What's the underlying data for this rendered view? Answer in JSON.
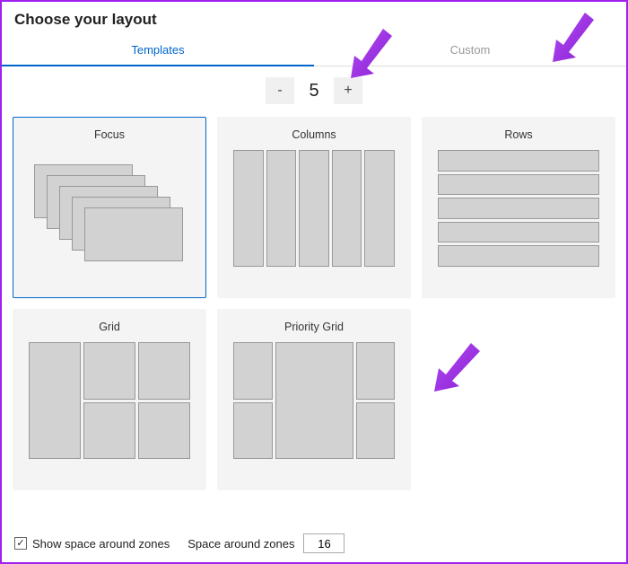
{
  "heading": "Choose your layout",
  "tabs": {
    "templates": "Templates",
    "custom": "Custom"
  },
  "stepper": {
    "minus": "-",
    "value": "5",
    "plus": "+"
  },
  "layouts": {
    "focus": "Focus",
    "columns": "Columns",
    "rows": "Rows",
    "grid": "Grid",
    "priority_grid": "Priority Grid"
  },
  "footer": {
    "show_space_label": "Show space around zones",
    "show_space_checked": true,
    "space_label": "Space around zones",
    "space_value": "16"
  }
}
